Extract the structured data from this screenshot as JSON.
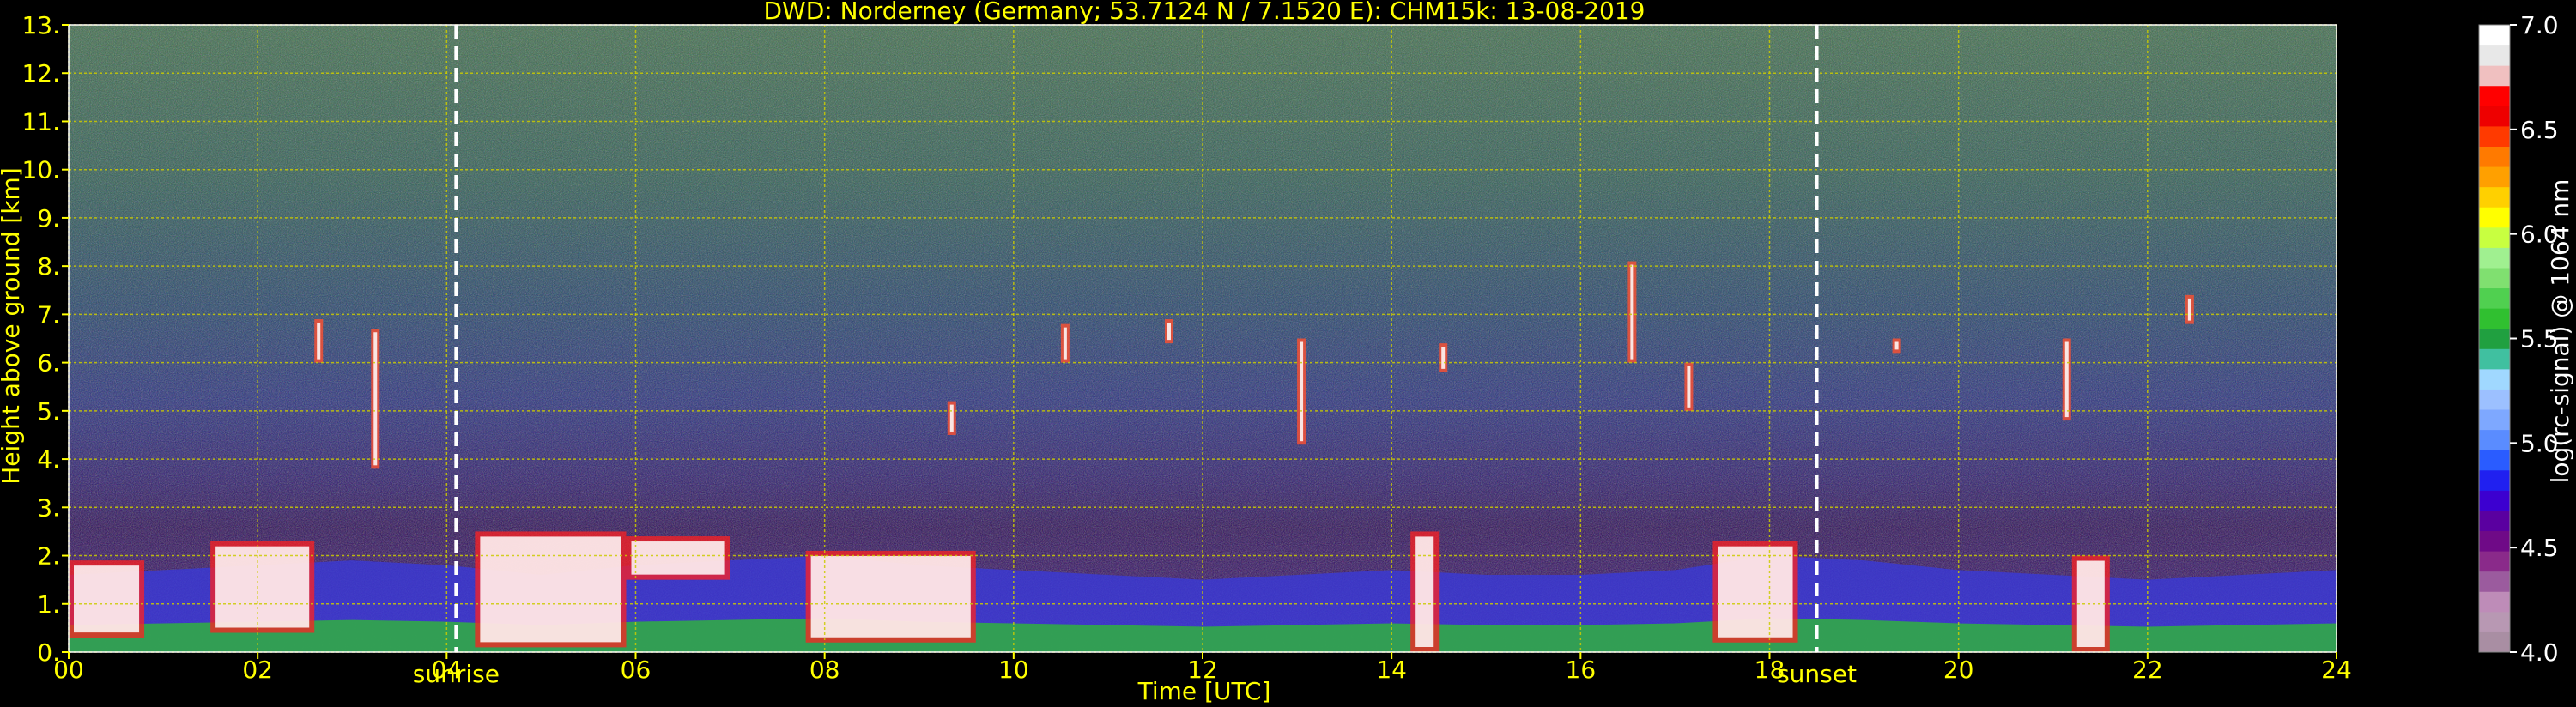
{
  "chart_data": {
    "type": "heatmap",
    "title": "DWD: Norderney (Germany; 53.7124 N / 7.1520 E):    CHM15k: 13-08-2019",
    "xlabel": "Time [UTC]",
    "ylabel": "Height above ground [km]",
    "xlim": [
      0,
      24
    ],
    "ylim": [
      0,
      13
    ],
    "x_ticks": [
      "00",
      "02",
      "04",
      "06",
      "08",
      "10",
      "12",
      "14",
      "16",
      "18",
      "20",
      "22",
      "24"
    ],
    "y_ticks": [
      "0.",
      "1.",
      "2.",
      "3.",
      "4.",
      "5.",
      "6.",
      "7.",
      "8.",
      "9.",
      "10.",
      "11.",
      "12.",
      "13."
    ],
    "grid": true,
    "markers": [
      {
        "label": "sunrise",
        "time": 4.1
      },
      {
        "label": "sunset",
        "time": 18.5
      }
    ],
    "colorbar": {
      "label": "log(rc-signal) @ 1064 nm",
      "min": 4.0,
      "max": 7.0,
      "ticks": [
        "4.0",
        "4.5",
        "5.0",
        "5.5",
        "6.0",
        "6.5",
        "7.0"
      ],
      "colors": [
        "#a98ea3",
        "#b898b3",
        "#be8cb8",
        "#9b5b9e",
        "#8a2a8a",
        "#6f0a87",
        "#5a00a0",
        "#3c00d0",
        "#2020f0",
        "#2a5cff",
        "#5a8cff",
        "#7ea8ff",
        "#9cc0ff",
        "#a0d8ff",
        "#40c0a0",
        "#20a040",
        "#30c030",
        "#50d050",
        "#80e070",
        "#a0f090",
        "#c8ff40",
        "#ffff00",
        "#ffd000",
        "#ffa000",
        "#ff7a00",
        "#ff3a00",
        "#ee0000",
        "#ff0000",
        "#f0c0c0",
        "#e8e8e8",
        "#ffffff"
      ]
    },
    "colors": {
      "text": "#ffff00",
      "grid": "#cccc00",
      "background": "#000000",
      "marker": "#ffffff"
    }
  }
}
